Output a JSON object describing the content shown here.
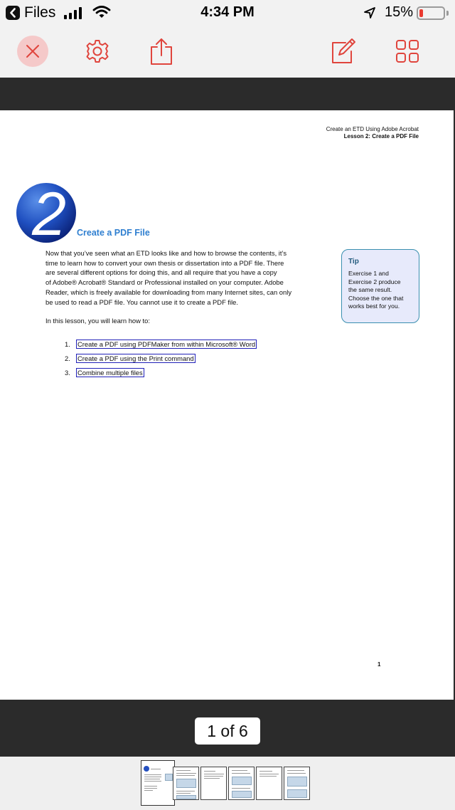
{
  "status_bar": {
    "back_app": "Files",
    "time": "4:34 PM",
    "battery_percent": "15%",
    "battery_level": 0.15,
    "icons": [
      "chevron-left-icon",
      "cellular-signal-icon",
      "wifi-icon",
      "location-arrow-icon",
      "battery-icon"
    ]
  },
  "toolbar": {
    "accent_color": "#e0453d",
    "buttons": [
      "close-icon",
      "gear-icon",
      "share-icon",
      "edit-pencil-icon",
      "grid-icon"
    ]
  },
  "document": {
    "header_line1": "Create an ETD Using Adobe Acrobat",
    "header_line2": "Lesson 2: Create a PDF File",
    "lesson_number": "2",
    "title": "Create a PDF File",
    "intro": [
      "Now that you’ve seen what an ETD looks like and how to browse the contents, it’s",
      "time to learn how to convert your own thesis or dissertation into a PDF file. There",
      "are several different options for doing this, and all require that you have a copy",
      "of Adobe® Acrobat® Standard or Professional installed on your computer. Adobe",
      "Reader, which is freely available for downloading from many Internet sites, can only",
      "be used to read a PDF file. You cannot use it to create a PDF file."
    ],
    "learn_intro": "In this lesson, you will learn how to:",
    "steps": [
      {
        "num": "1.",
        "text": "Create a PDF using PDFMaker from within Microsoft® Word"
      },
      {
        "num": "2.",
        "text": "Create a PDF using the Print command"
      },
      {
        "num": "3.",
        "text": "Combine multiple files"
      }
    ],
    "tip": {
      "heading": "Tip",
      "lines": [
        "Exercise 1 and",
        "Exercise 2 produce",
        "the same result.",
        "Choose the one that",
        "works best for you."
      ]
    },
    "page_number": "1"
  },
  "page_indicator": "1 of 6",
  "thumbnails": {
    "count": 6,
    "current": 1
  }
}
